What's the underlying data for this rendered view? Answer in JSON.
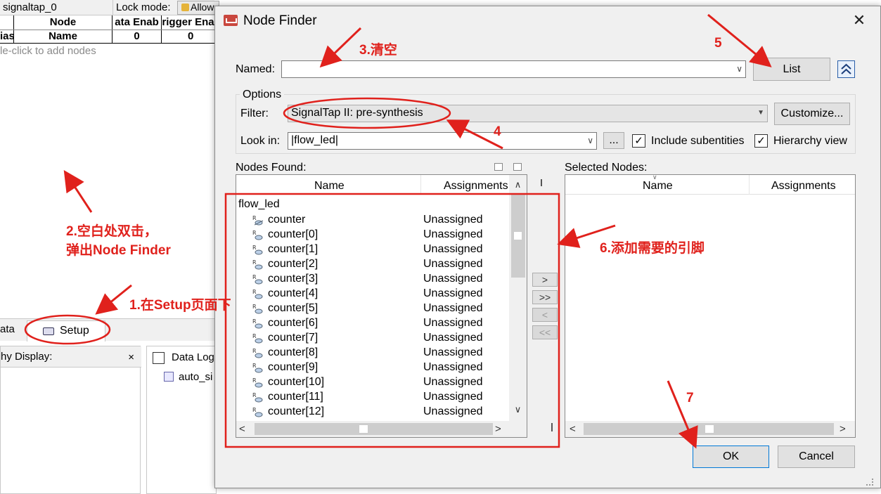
{
  "background": {
    "instance": "signaltap_0",
    "lock_mode_label": "Lock mode:",
    "lock_value": "Allow all changes",
    "head1": [
      "Node",
      "ata Enab",
      "rigger Ena"
    ],
    "head2": [
      "ias",
      "Name",
      "0",
      "0"
    ],
    "hint": "le-click to add nodes",
    "tab_data": "ata",
    "tab_setup": "Setup",
    "hierarchy_display": "hy Display:",
    "close_glyph": "×",
    "data_log": "Data Log",
    "auto_item": "auto_si"
  },
  "dialog": {
    "title": "Node Finder",
    "close_glyph": "✕",
    "named_label": "Named:",
    "named_value": "",
    "list_button": "List",
    "options_label": "Options",
    "filter_label": "Filter:",
    "filter_value": "SignalTap II: pre-synthesis",
    "customize_button": "Customize...",
    "lookin_label": "Look in:",
    "lookin_value": "|flow_led|",
    "browse_button": "...",
    "include_subentities": "Include subentities",
    "hierarchy_view": "Hierarchy view",
    "check_glyph": "✓",
    "nodes_found_label": "Nodes Found:",
    "selected_nodes_label": "Selected Nodes:",
    "col_name": "Name",
    "col_assignments": "Assignments",
    "root_node": "flow_led",
    "nodes": [
      {
        "name": "counter",
        "assign": "Unassigned"
      },
      {
        "name": "counter[0]",
        "assign": "Unassigned"
      },
      {
        "name": "counter[1]",
        "assign": "Unassigned"
      },
      {
        "name": "counter[2]",
        "assign": "Unassigned"
      },
      {
        "name": "counter[3]",
        "assign": "Unassigned"
      },
      {
        "name": "counter[4]",
        "assign": "Unassigned"
      },
      {
        "name": "counter[5]",
        "assign": "Unassigned"
      },
      {
        "name": "counter[6]",
        "assign": "Unassigned"
      },
      {
        "name": "counter[7]",
        "assign": "Unassigned"
      },
      {
        "name": "counter[8]",
        "assign": "Unassigned"
      },
      {
        "name": "counter[9]",
        "assign": "Unassigned"
      },
      {
        "name": "counter[10]",
        "assign": "Unassigned"
      },
      {
        "name": "counter[11]",
        "assign": "Unassigned"
      },
      {
        "name": "counter[12]",
        "assign": "Unassigned"
      }
    ],
    "move_buttons": [
      ">",
      ">>",
      "<",
      "<<"
    ],
    "ok_button": "OK",
    "cancel_button": "Cancel"
  },
  "annotations": {
    "step1": "1.在Setup页面下",
    "step2_line1": "2.空白处双击，",
    "step2_line2": "弹出Node Finder",
    "step3": "3.清空",
    "step4": "4",
    "step5": "5",
    "step6": "6.添加需要的引脚",
    "step7": "7",
    "color": "#e0211c"
  }
}
